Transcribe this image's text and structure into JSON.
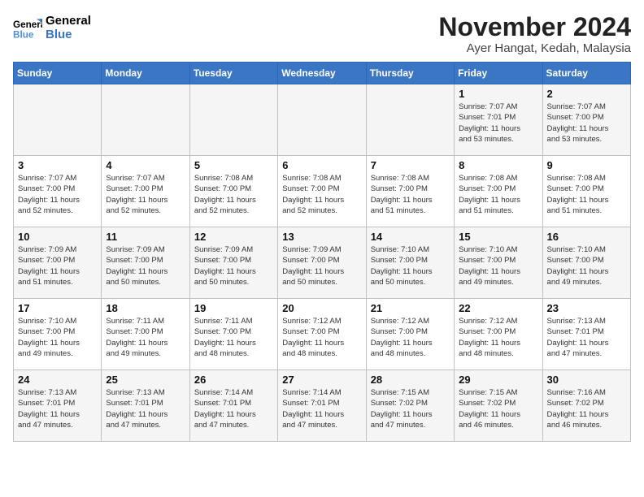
{
  "header": {
    "logo_line1": "General",
    "logo_line2": "Blue",
    "month": "November 2024",
    "location": "Ayer Hangat, Kedah, Malaysia"
  },
  "weekdays": [
    "Sunday",
    "Monday",
    "Tuesday",
    "Wednesday",
    "Thursday",
    "Friday",
    "Saturday"
  ],
  "weeks": [
    [
      {
        "day": "",
        "info": ""
      },
      {
        "day": "",
        "info": ""
      },
      {
        "day": "",
        "info": ""
      },
      {
        "day": "",
        "info": ""
      },
      {
        "day": "",
        "info": ""
      },
      {
        "day": "1",
        "info": "Sunrise: 7:07 AM\nSunset: 7:01 PM\nDaylight: 11 hours\nand 53 minutes."
      },
      {
        "day": "2",
        "info": "Sunrise: 7:07 AM\nSunset: 7:00 PM\nDaylight: 11 hours\nand 53 minutes."
      }
    ],
    [
      {
        "day": "3",
        "info": "Sunrise: 7:07 AM\nSunset: 7:00 PM\nDaylight: 11 hours\nand 52 minutes."
      },
      {
        "day": "4",
        "info": "Sunrise: 7:07 AM\nSunset: 7:00 PM\nDaylight: 11 hours\nand 52 minutes."
      },
      {
        "day": "5",
        "info": "Sunrise: 7:08 AM\nSunset: 7:00 PM\nDaylight: 11 hours\nand 52 minutes."
      },
      {
        "day": "6",
        "info": "Sunrise: 7:08 AM\nSunset: 7:00 PM\nDaylight: 11 hours\nand 52 minutes."
      },
      {
        "day": "7",
        "info": "Sunrise: 7:08 AM\nSunset: 7:00 PM\nDaylight: 11 hours\nand 51 minutes."
      },
      {
        "day": "8",
        "info": "Sunrise: 7:08 AM\nSunset: 7:00 PM\nDaylight: 11 hours\nand 51 minutes."
      },
      {
        "day": "9",
        "info": "Sunrise: 7:08 AM\nSunset: 7:00 PM\nDaylight: 11 hours\nand 51 minutes."
      }
    ],
    [
      {
        "day": "10",
        "info": "Sunrise: 7:09 AM\nSunset: 7:00 PM\nDaylight: 11 hours\nand 51 minutes."
      },
      {
        "day": "11",
        "info": "Sunrise: 7:09 AM\nSunset: 7:00 PM\nDaylight: 11 hours\nand 50 minutes."
      },
      {
        "day": "12",
        "info": "Sunrise: 7:09 AM\nSunset: 7:00 PM\nDaylight: 11 hours\nand 50 minutes."
      },
      {
        "day": "13",
        "info": "Sunrise: 7:09 AM\nSunset: 7:00 PM\nDaylight: 11 hours\nand 50 minutes."
      },
      {
        "day": "14",
        "info": "Sunrise: 7:10 AM\nSunset: 7:00 PM\nDaylight: 11 hours\nand 50 minutes."
      },
      {
        "day": "15",
        "info": "Sunrise: 7:10 AM\nSunset: 7:00 PM\nDaylight: 11 hours\nand 49 minutes."
      },
      {
        "day": "16",
        "info": "Sunrise: 7:10 AM\nSunset: 7:00 PM\nDaylight: 11 hours\nand 49 minutes."
      }
    ],
    [
      {
        "day": "17",
        "info": "Sunrise: 7:10 AM\nSunset: 7:00 PM\nDaylight: 11 hours\nand 49 minutes."
      },
      {
        "day": "18",
        "info": "Sunrise: 7:11 AM\nSunset: 7:00 PM\nDaylight: 11 hours\nand 49 minutes."
      },
      {
        "day": "19",
        "info": "Sunrise: 7:11 AM\nSunset: 7:00 PM\nDaylight: 11 hours\nand 48 minutes."
      },
      {
        "day": "20",
        "info": "Sunrise: 7:12 AM\nSunset: 7:00 PM\nDaylight: 11 hours\nand 48 minutes."
      },
      {
        "day": "21",
        "info": "Sunrise: 7:12 AM\nSunset: 7:00 PM\nDaylight: 11 hours\nand 48 minutes."
      },
      {
        "day": "22",
        "info": "Sunrise: 7:12 AM\nSunset: 7:00 PM\nDaylight: 11 hours\nand 48 minutes."
      },
      {
        "day": "23",
        "info": "Sunrise: 7:13 AM\nSunset: 7:01 PM\nDaylight: 11 hours\nand 47 minutes."
      }
    ],
    [
      {
        "day": "24",
        "info": "Sunrise: 7:13 AM\nSunset: 7:01 PM\nDaylight: 11 hours\nand 47 minutes."
      },
      {
        "day": "25",
        "info": "Sunrise: 7:13 AM\nSunset: 7:01 PM\nDaylight: 11 hours\nand 47 minutes."
      },
      {
        "day": "26",
        "info": "Sunrise: 7:14 AM\nSunset: 7:01 PM\nDaylight: 11 hours\nand 47 minutes."
      },
      {
        "day": "27",
        "info": "Sunrise: 7:14 AM\nSunset: 7:01 PM\nDaylight: 11 hours\nand 47 minutes."
      },
      {
        "day": "28",
        "info": "Sunrise: 7:15 AM\nSunset: 7:02 PM\nDaylight: 11 hours\nand 47 minutes."
      },
      {
        "day": "29",
        "info": "Sunrise: 7:15 AM\nSunset: 7:02 PM\nDaylight: 11 hours\nand 46 minutes."
      },
      {
        "day": "30",
        "info": "Sunrise: 7:16 AM\nSunset: 7:02 PM\nDaylight: 11 hours\nand 46 minutes."
      }
    ]
  ]
}
